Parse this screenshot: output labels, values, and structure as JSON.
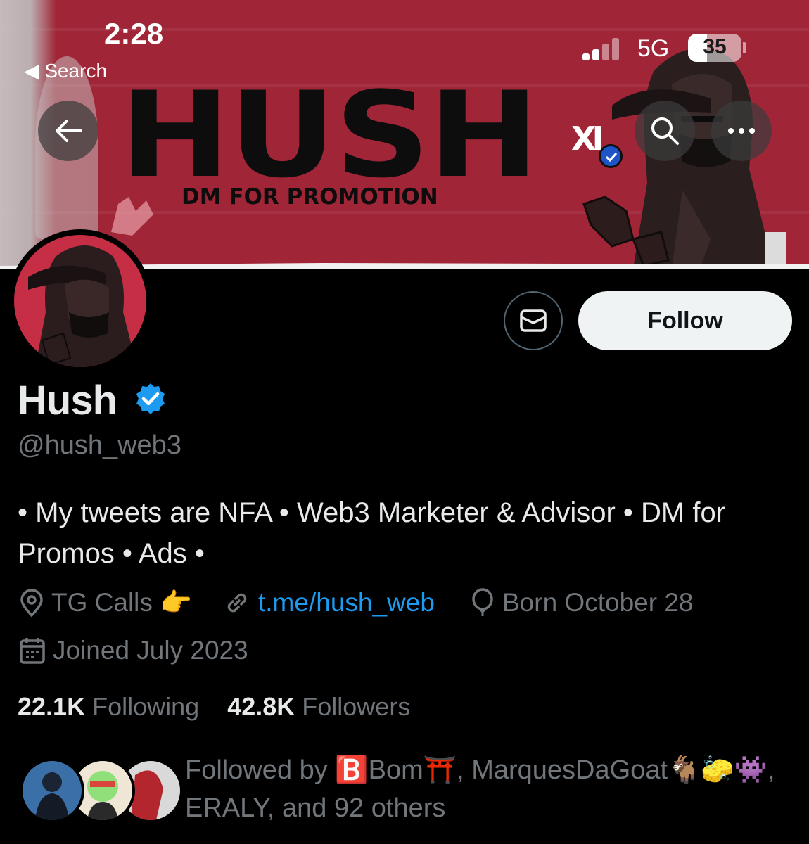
{
  "status_bar": {
    "time": "2:28",
    "back_label": "◀ Search",
    "network": "5G",
    "battery": "35",
    "battery_level": 0.35
  },
  "banner": {
    "title": "HUSH",
    "subtitle": "DM FOR PROMOTION",
    "logo_text": "XI",
    "background_color": "#a02637",
    "icons": {
      "back": "arrow-left-icon",
      "search": "search-icon",
      "more": "more-dots-icon"
    }
  },
  "profile": {
    "name": "Hush",
    "handle": "@hush_web3",
    "bio": "• My tweets are NFA • Web3 Marketer & Advisor • DM for Promos • Ads •",
    "location": "TG Calls 👉",
    "link": "t.me/hush_web",
    "birthday": "Born October 28",
    "joined": "Joined July 2023",
    "following_count": "22.1K",
    "following_label": "Following",
    "followers_count": "42.8K",
    "followers_label": "Followers",
    "followed_by": "Followed by 🅱️Bom⛩️, MarquesDaGoat🐐🧽👾, ERALY, and 92 others"
  },
  "actions": {
    "follow_label": "Follow",
    "message_icon": "envelope-icon"
  },
  "colors": {
    "accent": "#1d9bf0",
    "muted": "#71767b",
    "text": "#e7e9ea",
    "follow_bg": "#eff3f4"
  }
}
